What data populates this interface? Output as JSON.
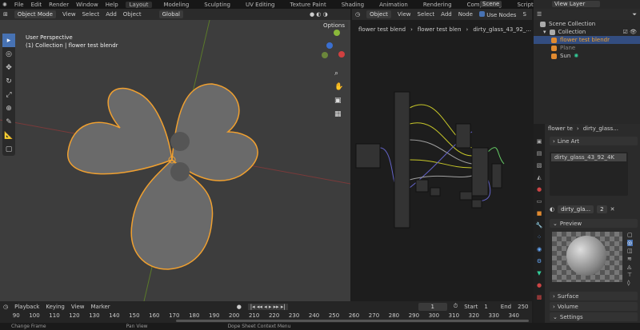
{
  "menu": [
    "File",
    "Edit",
    "Render",
    "Window",
    "Help"
  ],
  "workspaces": [
    "Layout",
    "Modeling",
    "Sculpting",
    "UV Editing",
    "Texture Paint",
    "Shading",
    "Animation",
    "Rendering",
    "Compositing",
    "Scripting"
  ],
  "active_workspace": "Layout",
  "scene": "Scene",
  "view_layer": "View Layer",
  "viewport": {
    "mode": "Object Mode",
    "menus": [
      "View",
      "Select",
      "Add",
      "Object"
    ],
    "orientation": "Global",
    "options": "Options",
    "perspective": "User Perspective",
    "collection_info": "(1) Collection | flower test blendr"
  },
  "node_editor": {
    "type": "Object",
    "menus": [
      "View",
      "Select",
      "Add",
      "Node"
    ],
    "use_nodes": "Use Nodes",
    "slot": "S",
    "breadcrumb": [
      "flower test blend",
      "flower test blen",
      "dirty_glass_43_92_..."
    ]
  },
  "outliner": {
    "root": "Scene Collection",
    "collection": "Collection",
    "items": [
      {
        "name": "flower test blendr",
        "selected": true
      },
      {
        "name": "Plane",
        "selected": false
      },
      {
        "name": "Sun",
        "selected": false
      }
    ]
  },
  "properties": {
    "breadcrumb": [
      "flower te",
      "dirty_glass..."
    ],
    "line_art": "Line Art",
    "material_slot": "dirty_glass_43_92_4K",
    "material_name": "dirty_gla...",
    "users": "2",
    "sections": {
      "preview": "Preview",
      "surface": "Surface",
      "volume": "Volume",
      "settings": "Settings"
    }
  },
  "timeline": {
    "menus": [
      "Playback",
      "Keying",
      "View",
      "Marker"
    ],
    "current_frame": "1",
    "start_label": "Start",
    "start": "1",
    "end_label": "End",
    "end": "250",
    "ticks": [
      "90",
      "100",
      "110",
      "120",
      "130",
      "140",
      "150",
      "160",
      "170",
      "180",
      "190",
      "200",
      "210",
      "220",
      "230",
      "240",
      "250",
      "260",
      "270",
      "280",
      "290",
      "300",
      "310",
      "320",
      "330",
      "340"
    ]
  },
  "status": [
    "Change Frame",
    "Pan View",
    "Dope Sheet Context Menu"
  ],
  "colors": {
    "accent": "#4772b3",
    "selection": "#f0a030"
  }
}
